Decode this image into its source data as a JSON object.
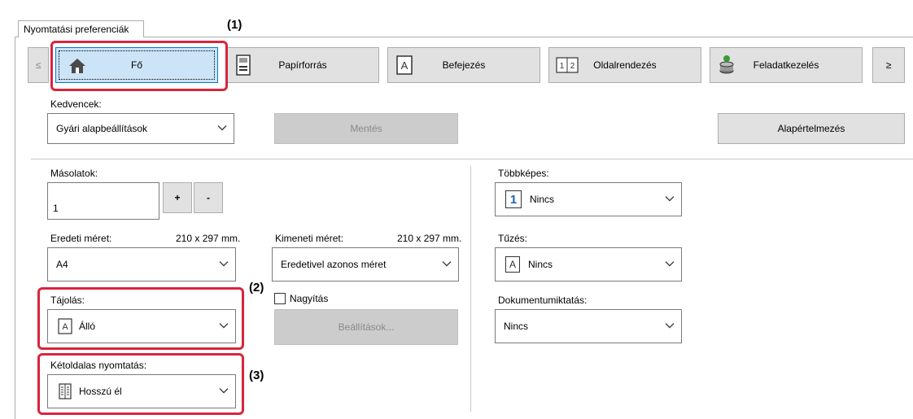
{
  "window": {
    "tab_label": "Nyomtatási preferenciák"
  },
  "tabs": {
    "prev": "≤",
    "next": "≥",
    "items": [
      {
        "label": "Fő",
        "icon": "home-icon"
      },
      {
        "label": "Papírforrás",
        "icon": "paper-tray-icon"
      },
      {
        "label": "Befejezés",
        "icon": "finishing-icon"
      },
      {
        "label": "Oldalrendezés",
        "icon": "layout-icon"
      },
      {
        "label": "Feladatkezelés",
        "icon": "job-handling-icon"
      }
    ]
  },
  "favorites": {
    "label": "Kedvencek:",
    "value": "Gyári alapbeállítások",
    "save_label": "Mentés",
    "defaults_label": "Alapértelmezés"
  },
  "copies": {
    "label": "Másolatok:",
    "value": "1",
    "plus": "+",
    "minus": "-"
  },
  "original_size": {
    "label": "Eredeti méret:",
    "dims": "210 x 297 mm.",
    "value": "A4"
  },
  "output_size": {
    "label": "Kimeneti méret:",
    "dims": "210 x 297 mm.",
    "value": "Eredetivel azonos méret"
  },
  "orientation": {
    "label": "Tájolás:",
    "value": "Álló"
  },
  "zoom": {
    "label": "Nagyítás",
    "checked": false,
    "settings_label": "Beállítások..."
  },
  "duplex": {
    "label": "Kétoldalas nyomtatás:",
    "value": "Hosszú él"
  },
  "multipage": {
    "label": "Többképes:",
    "value": "Nincs",
    "icon_text": "1"
  },
  "stapling": {
    "label": "Tűzés:",
    "value": "Nincs",
    "icon_text": "A"
  },
  "doc_filing": {
    "label": "Dokumentumiktatás:",
    "value": "Nincs"
  },
  "callouts": {
    "c1": "(1)",
    "c2": "(2)",
    "c3": "(3)"
  },
  "colors": {
    "highlight": "#d7263d",
    "accent": "#0078d7",
    "active_tab_bg": "#cce4f7"
  }
}
